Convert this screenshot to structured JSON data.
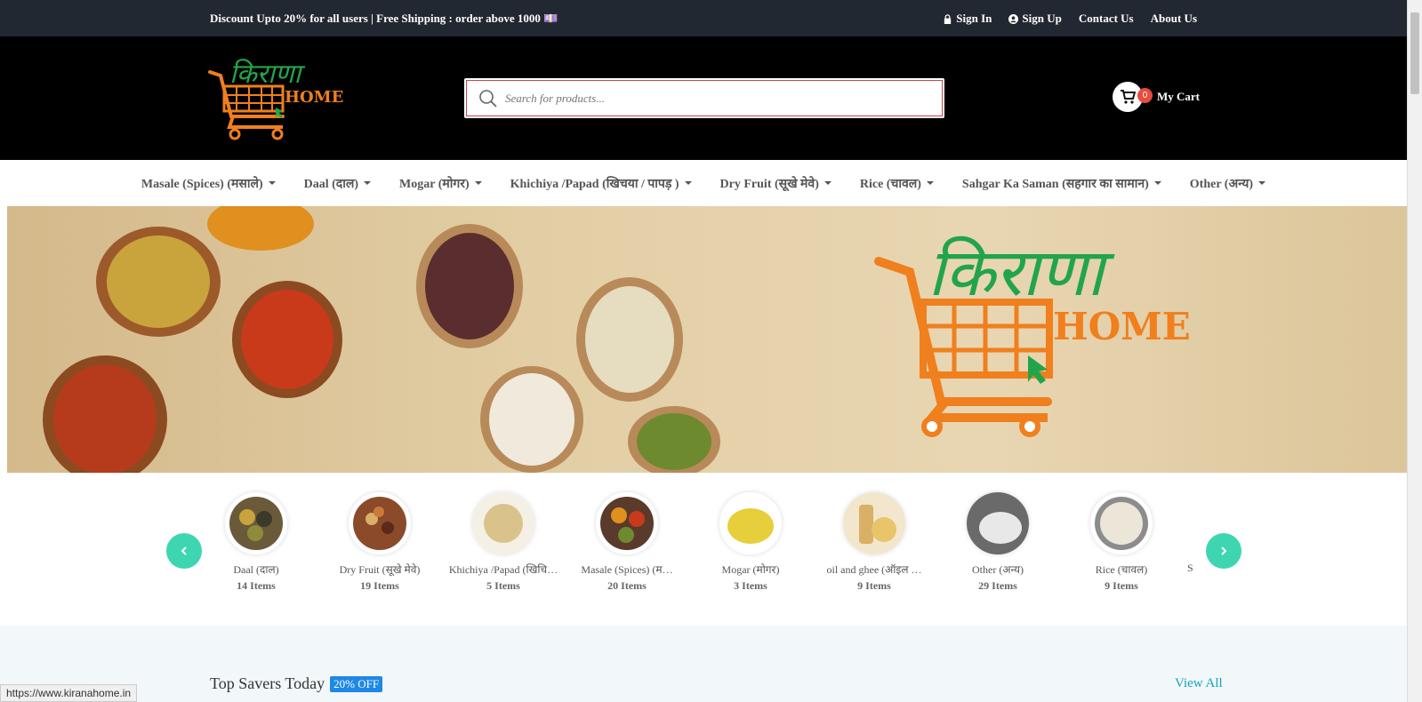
{
  "topbar": {
    "promo": "Discount Upto 20% for all users | Free Shipping : order above 1000 💷",
    "links": [
      "Sign In",
      "Sign Up",
      "Contact Us",
      "About Us"
    ]
  },
  "header": {
    "logo_text_hindi": "किराणा",
    "logo_text_en": "HOME",
    "search_placeholder": "Search for products...",
    "cart_count": "0",
    "cart_label": "My Cart"
  },
  "nav": {
    "items": [
      "Masale (Spices) (मसाले)",
      "Daal (दाल)",
      "Mogar (मोगर)",
      "Khichiya /Papad (खिचया / पापड़ )",
      "Dry Fruit (सूखे मेवे)",
      "Rice (चावल)",
      "Sahgar Ka Saman (सहगार का सामान)",
      "Other (अन्य)"
    ]
  },
  "banner": {
    "logo_hindi": "किराणा",
    "logo_en": "HOME"
  },
  "categories": [
    {
      "name": "Daal (दाल)",
      "count": "14 Items",
      "color": "#6b5a3a"
    },
    {
      "name": "Dry Fruit (सूखे मेवे)",
      "count": "19 Items",
      "color": "#8b4a2a"
    },
    {
      "name": "Khichiya /Papad (खिचि…",
      "count": "5 Items",
      "color": "#d9c38b"
    },
    {
      "name": "Masale (Spices) (म…",
      "count": "20 Items",
      "color": "#b5532a"
    },
    {
      "name": "Mogar (मोगर)",
      "count": "3 Items",
      "color": "#e6cf3a"
    },
    {
      "name": "oil and ghee (ऑइल …",
      "count": "9 Items",
      "color": "#d9b066"
    },
    {
      "name": "Other (अन्य)",
      "count": "29 Items",
      "color": "#8c8c8c"
    },
    {
      "name": "Rice (चावल)",
      "count": "9 Items",
      "color": "#d8d2c6"
    },
    {
      "name": "S",
      "count": "",
      "color": "#ffffff"
    }
  ],
  "savers": {
    "title": "Top Savers Today",
    "badge": "20% OFF",
    "view_all": "View All"
  },
  "status_url": "https://www.kiranahome.in"
}
